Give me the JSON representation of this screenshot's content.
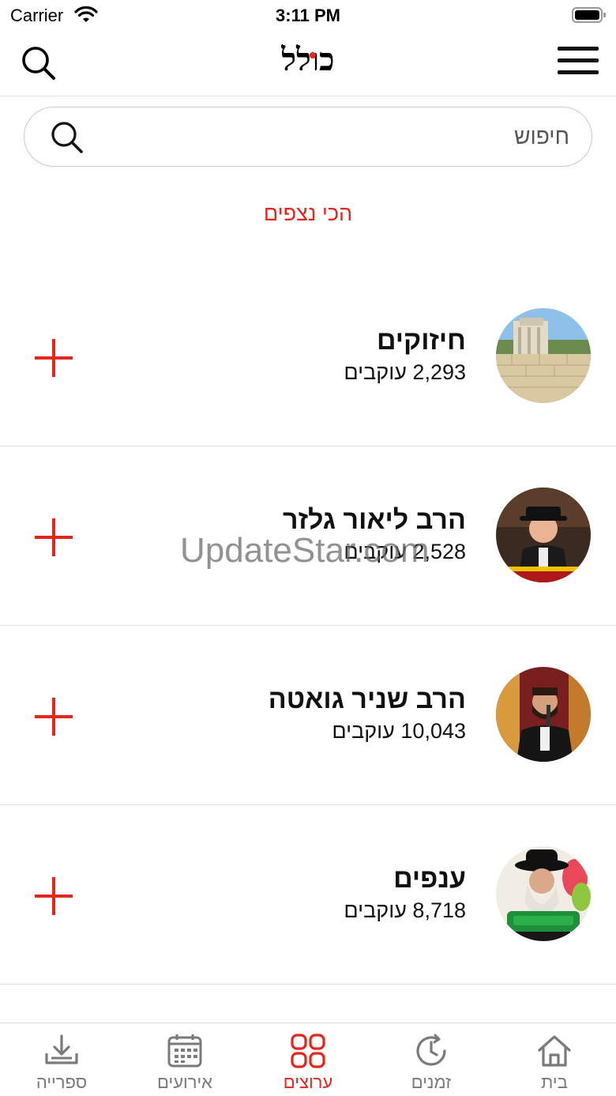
{
  "status_bar": {
    "carrier": "Carrier",
    "time": "3:11 PM"
  },
  "header": {
    "logo": "כולל"
  },
  "search": {
    "placeholder": "חיפוש",
    "value": ""
  },
  "section": {
    "title": "הכי נצפים"
  },
  "items": [
    {
      "name": "חיזוקים",
      "followers": "2,293 עוקבים",
      "avatar": "wall-image"
    },
    {
      "name": "הרב ליאור גלזר",
      "followers": "2,528 עוקבים",
      "avatar": "speaker-photo"
    },
    {
      "name": "הרב שניר גואטה",
      "followers": "10,043 עוקבים",
      "avatar": "speaker-photo"
    },
    {
      "name": "ענפים",
      "followers": "8,718 עוקבים",
      "avatar": "speaker-photo"
    }
  ],
  "watermark": "UpdateStar.com",
  "tabs": [
    {
      "label": "ספרייה",
      "icon": "download-icon",
      "active": false
    },
    {
      "label": "אירועים",
      "icon": "calendar-icon",
      "active": false
    },
    {
      "label": "ערוצים",
      "icon": "channels-icon",
      "active": true
    },
    {
      "label": "זמנים",
      "icon": "clock-icon",
      "active": false
    },
    {
      "label": "בית",
      "icon": "home-icon",
      "active": false
    }
  ],
  "colors": {
    "accent": "#e5261c",
    "text": "#111111",
    "muted": "#7a7a7a"
  }
}
